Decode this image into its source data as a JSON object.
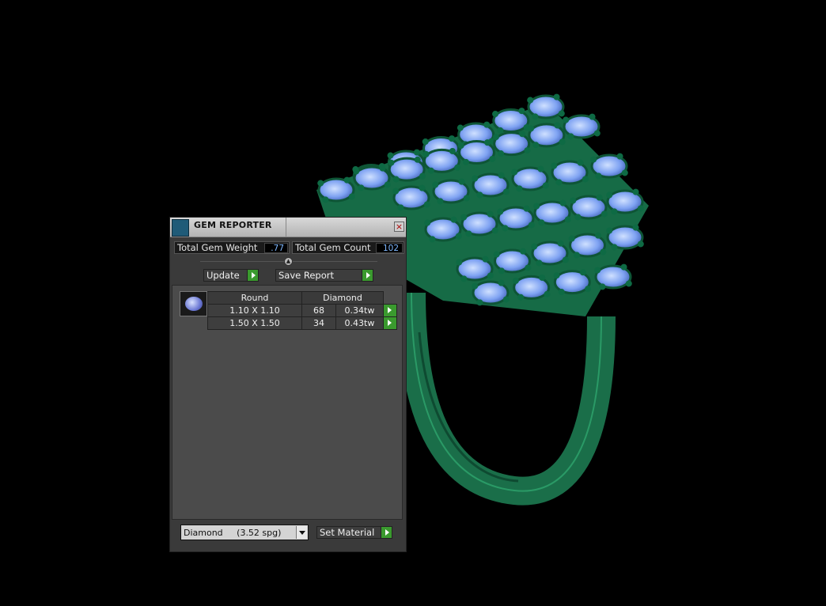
{
  "window": {
    "title": "GEM REPORTER",
    "close_symbol": "×"
  },
  "stats": {
    "weight_label": "Total Gem Weight",
    "weight_value": ".77",
    "count_label": "Total Gem Count",
    "count_value": "102"
  },
  "actions": {
    "update_label": "Update",
    "save_label": "Save Report"
  },
  "gem_table": {
    "headers": [
      "Round",
      "Diamond"
    ],
    "rows": [
      {
        "size": "1.10 X 1.10",
        "count": "68",
        "weight": "0.34tw"
      },
      {
        "size": "1.50 X 1.50",
        "count": "34",
        "weight": "0.43tw"
      }
    ]
  },
  "material": {
    "selected": "Diamond     (3.52 spg)",
    "set_label": "Set Material"
  },
  "colors": {
    "ring_metal": "#1f7a52",
    "gem": "#7ea2f2",
    "go_button": "#3a9a2e"
  },
  "icons": [
    "gem-reporter-app-icon",
    "close-icon",
    "collapse-handle-icon",
    "go-arrow-icon",
    "dropdown-arrow-icon"
  ]
}
